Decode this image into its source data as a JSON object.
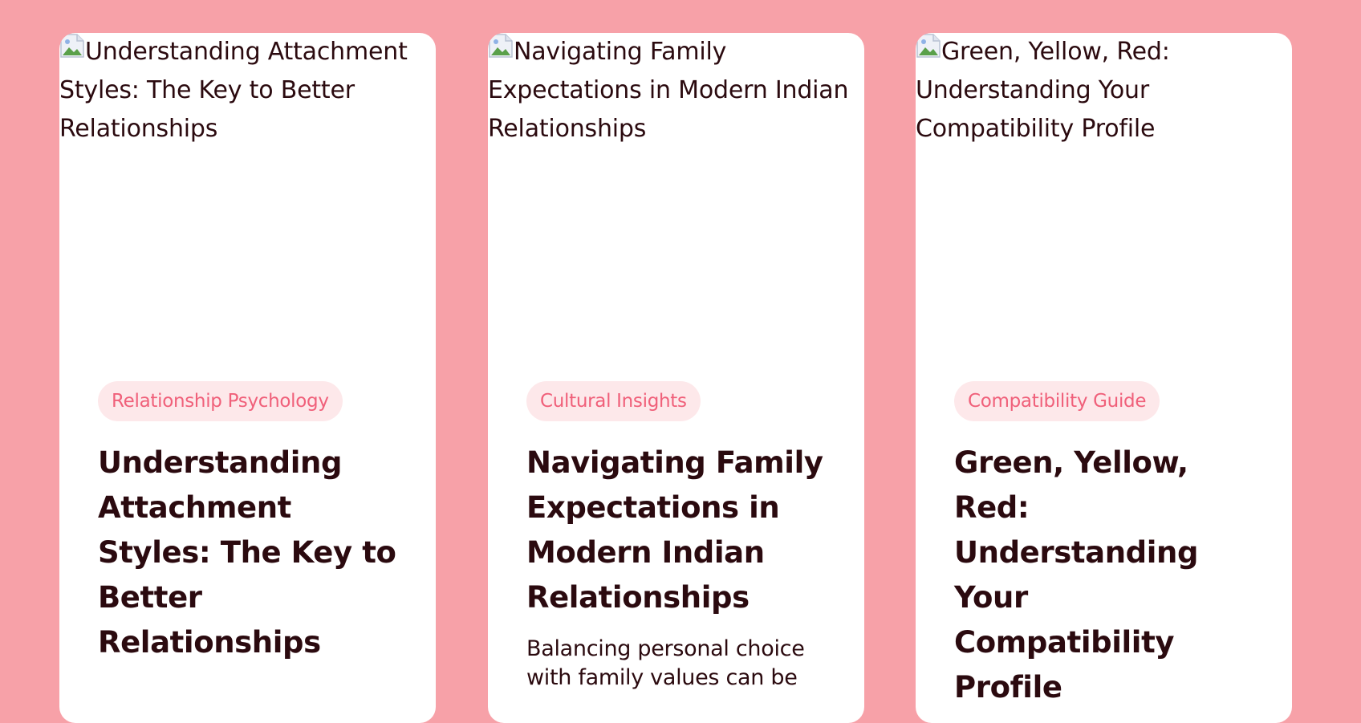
{
  "cards": [
    {
      "image_alt": "Understanding Attachment Styles: The Key to Better Relationships",
      "category": "Relationship Psychology",
      "title": "Understanding Attachment Styles: The Key to Better Relationships",
      "excerpt": ""
    },
    {
      "image_alt": "Navigating Family Expectations in Modern Indian Relationships",
      "category": "Cultural Insights",
      "title": "Navigating Family Expectations in Modern Indian Relationships",
      "excerpt": "Balancing personal choice with family values can be"
    },
    {
      "image_alt": "Green, Yellow, Red: Understanding Your Compatibility Profile",
      "category": "Compatibility Guide",
      "title": "Green, Yellow, Red: Understanding Your Compatibility Profile",
      "excerpt": ""
    }
  ],
  "colors": {
    "page_background": "#f7a1a8",
    "card_background": "#ffffff",
    "tag_background": "#fde8ea",
    "tag_text": "#f0607a",
    "heading_text": "#2b0a0f"
  },
  "icons": {
    "broken_image": "broken-image-icon"
  }
}
